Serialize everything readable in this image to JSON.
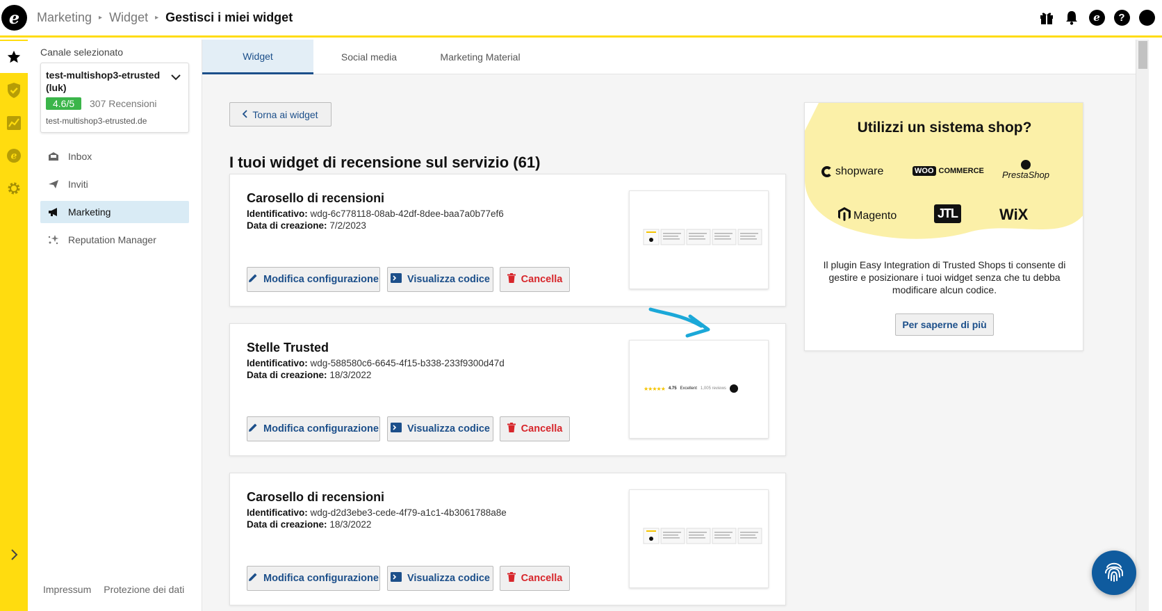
{
  "header": {
    "logo": "e",
    "breadcrumb": [
      "Marketing",
      "Widget"
    ],
    "current": "Gestisci i miei widget",
    "icons": [
      "gift-icon",
      "bell-icon",
      "trustedshops-icon",
      "help-icon",
      "account-icon"
    ]
  },
  "rail": {
    "icons": [
      "star-icon",
      "shield-check-icon",
      "chart-icon",
      "trustedshops-e-icon",
      "gear-icon"
    ],
    "expand_icon": "chevron-right-icon"
  },
  "sidebar": {
    "channel_label": "Canale selezionato",
    "channel": {
      "name": "test-multishop3-etrusted (luk)",
      "rating": "4.6/5",
      "reviews": "307 Recensioni",
      "domain": "test-multishop3-etrusted.de"
    },
    "nav": [
      {
        "label": "Inbox",
        "icon": "inbox-icon"
      },
      {
        "label": "Inviti",
        "icon": "send-icon"
      },
      {
        "label": "Marketing",
        "icon": "megaphone-icon",
        "active": true
      },
      {
        "label": "Reputation Manager",
        "icon": "sparkle-stars-icon"
      }
    ],
    "footer": {
      "impressum": "Impressum",
      "privacy": "Protezione dei dati"
    }
  },
  "tabs": [
    {
      "label": "Widget",
      "active": true
    },
    {
      "label": "Social media"
    },
    {
      "label": "Marketing Material"
    }
  ],
  "main": {
    "back_label": "Torna ai widget",
    "title": "I tuoi widget di recensione sul servizio (61)",
    "id_label": "Identificativo:",
    "date_label": "Data di creazione:",
    "edit_label": "Modifica configurazione",
    "code_label": "Visualizza codice",
    "delete_label": "Cancella",
    "widgets": [
      {
        "title": "Carosello di recensioni",
        "id": "wdg-6c778118-08ab-42df-8dee-baa7a0b77ef6",
        "date": "7/2/2023",
        "preview": "carousel"
      },
      {
        "title": "Stelle Trusted",
        "id": "wdg-588580c6-6645-4f15-b338-233f9300d47d",
        "date": "18/3/2022",
        "preview": "stars"
      },
      {
        "title": "Carosello di recensioni",
        "id": "wdg-d2d3ebe3-cede-4f79-a1c1-4b3061788a8e",
        "date": "18/3/2022",
        "preview": "carousel"
      }
    ],
    "stars_preview": {
      "score": "4.75",
      "grade": "Excellent",
      "count": "1,005 reviews"
    }
  },
  "promo": {
    "title": "Utilizzi un sistema shop?",
    "logos": [
      "shopware",
      "COMMERCE",
      "PrestaShop",
      "Magento",
      "JTL",
      "WiX"
    ],
    "woo": "WOO",
    "text": "Il plugin Easy Integration di Trusted Shops ti consente di gestire e posizionare i tuoi widget senza che tu debba modificare alcun codice.",
    "button": "Per saperne di più"
  },
  "colors": {
    "accent_yellow": "#ffdc0f",
    "primary_blue": "#1c4f8a",
    "danger_red": "#d7262b",
    "rating_green": "#3bb54a",
    "annotation_arrow": "#1ba8d8"
  },
  "fingerprint_icon": "fingerprint-icon"
}
